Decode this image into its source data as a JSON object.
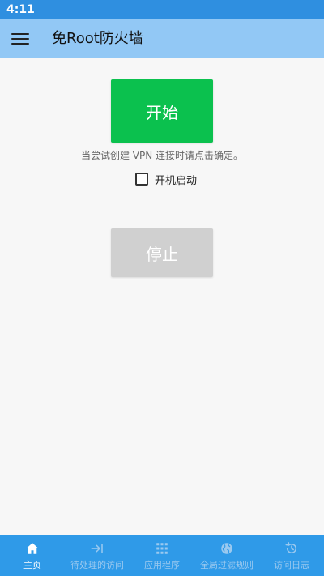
{
  "status_bar": {
    "time": "4:11"
  },
  "app_bar": {
    "title": "免Root防火墙"
  },
  "main": {
    "start_label": "开始",
    "hint": "当尝试创建 VPN 连接时请点击确定。",
    "autostart_label": "开机启动",
    "autostart_checked": false,
    "stop_label": "停止"
  },
  "bottom_nav": {
    "active_index": 0,
    "items": [
      {
        "label": "主页",
        "icon": "home-icon"
      },
      {
        "label": "待处理的访问",
        "icon": "arrow-to-bar-icon"
      },
      {
        "label": "应用程序",
        "icon": "grid-icon"
      },
      {
        "label": "全局过滤规则",
        "icon": "globe-icon"
      },
      {
        "label": "访问日志",
        "icon": "history-icon"
      }
    ]
  },
  "colors": {
    "status_bar": "#2f8fe0",
    "app_bar": "#92c8f5",
    "start_button": "#0bc14e",
    "stop_button": "#d0d0d0",
    "bottom_nav": "#2f9ae8"
  }
}
